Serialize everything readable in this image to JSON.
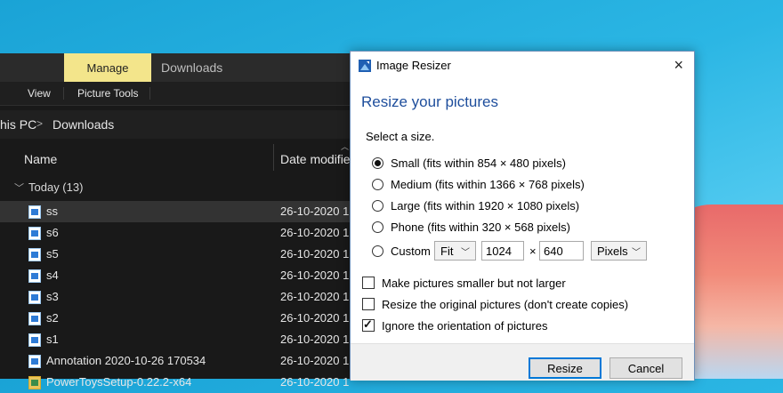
{
  "explorer": {
    "ribbon": {
      "manage_label": "Manage",
      "title": "Downloads",
      "view_label": "View",
      "picture_tools_label": "Picture Tools"
    },
    "address": {
      "this_pc": "his PC",
      "separator": ">",
      "current": "Downloads"
    },
    "columns": {
      "name": "Name",
      "date": "Date modifie"
    },
    "group": {
      "label": "Today (13)"
    },
    "files": [
      {
        "name": "ss",
        "date": "26-10-2020 1",
        "selected": true
      },
      {
        "name": "s6",
        "date": "26-10-2020 1"
      },
      {
        "name": "s5",
        "date": "26-10-2020 1"
      },
      {
        "name": "s4",
        "date": "26-10-2020 1"
      },
      {
        "name": "s3",
        "date": "26-10-2020 1"
      },
      {
        "name": "s2",
        "date": "26-10-2020 1"
      },
      {
        "name": "s1",
        "date": "26-10-2020 1"
      },
      {
        "name": "Annotation 2020-10-26 170534",
        "date": "26-10-2020 1"
      },
      {
        "name": "PowerToysSetup-0.22.2-x64",
        "date": "26-10-2020 1"
      }
    ]
  },
  "dialog": {
    "title": "Image Resizer",
    "close_glyph": "×",
    "heading": "Resize your pictures",
    "select_label": "Select a size.",
    "sizes": [
      {
        "label": "Small (fits within 854 × 480 pixels)",
        "checked": true
      },
      {
        "label": "Medium (fits within 1366 × 768 pixels)",
        "checked": false
      },
      {
        "label": "Large (fits within 1920 × 1080 pixels)",
        "checked": false
      },
      {
        "label": "Phone (fits within 320 × 568 pixels)",
        "checked": false
      }
    ],
    "custom": {
      "label": "Custom",
      "fit_value": "Fit",
      "width": "1024",
      "times": "×",
      "height": "640",
      "unit_value": "Pixels"
    },
    "options": [
      {
        "label": "Make pictures smaller but not larger",
        "checked": false
      },
      {
        "label": "Resize the original pictures (don't create copies)",
        "checked": false
      },
      {
        "label": "Ignore the orientation of pictures",
        "checked": true
      }
    ],
    "buttons": {
      "resize": "Resize",
      "cancel": "Cancel"
    }
  }
}
